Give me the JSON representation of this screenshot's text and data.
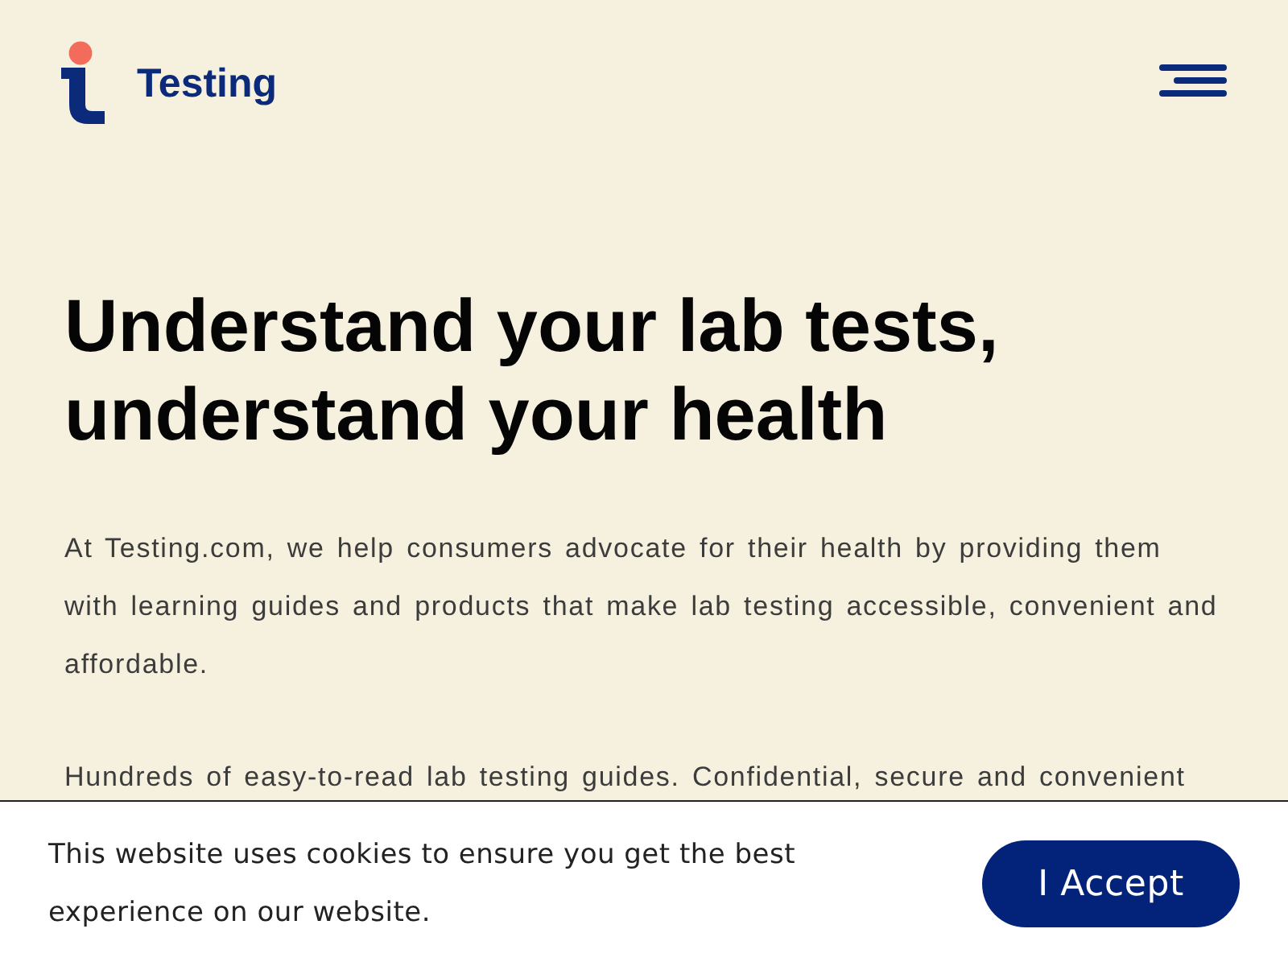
{
  "header": {
    "brand": "Testing"
  },
  "hero": {
    "heading": "Understand your lab tests, understand your health",
    "paragraphs": [
      "At Testing.com, we help consumers advocate for their health by providing them with learning guides and products that make lab testing accessible, convenient and affordable.",
      "Hundreds of easy-to-read lab testing guides. Confidential, secure and convenient"
    ]
  },
  "cookie_banner": {
    "message": "This website uses cookies to ensure you get the best experience on our website.",
    "button": "I Accept"
  }
}
